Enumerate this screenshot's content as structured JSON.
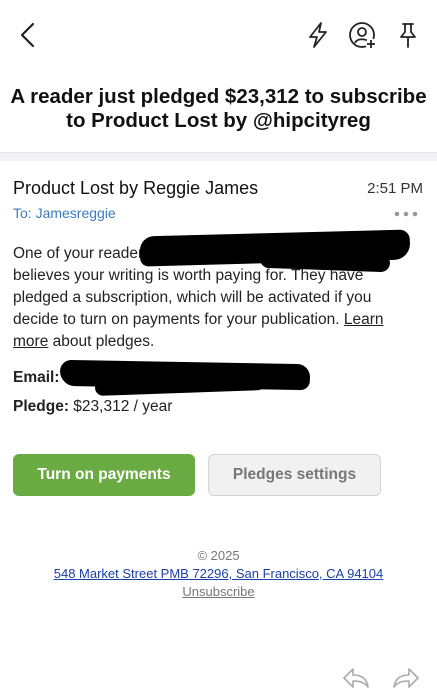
{
  "topbar": {
    "icons": [
      "back-chevron-icon",
      "lightning-bolt-icon",
      "person-add-icon",
      "pin-icon"
    ]
  },
  "email": {
    "subject": "A reader just pledged $23,312 to subscribe to Product Lost by @hipcityreg",
    "sender": "Product Lost by Reggie James",
    "time": "2:51 PM",
    "to": "To: Jamesreggie",
    "body_start": "One of your readers",
    "body_mid": "believes your writing is worth paying for. They have pledged a subscription, which will be activated if you decide to turn on payments for your publication. ",
    "learn_more": "Learn more",
    "body_end": " about pledges.",
    "email_label": "Email:",
    "pledge_label": "Pledge:",
    "pledge_value": "$23,312 / year"
  },
  "buttons": {
    "primary": "Turn on payments",
    "secondary": "Pledges settings"
  },
  "footer": {
    "copyright": "© 2025",
    "address": "548 Market Street PMB 72296, San Francisco, CA 94104",
    "unsubscribe": "Unsubscribe"
  },
  "colors": {
    "accent_green": "#6bab43",
    "link_blue": "#3a7bbf",
    "footer_link": "#1b3fa8"
  }
}
